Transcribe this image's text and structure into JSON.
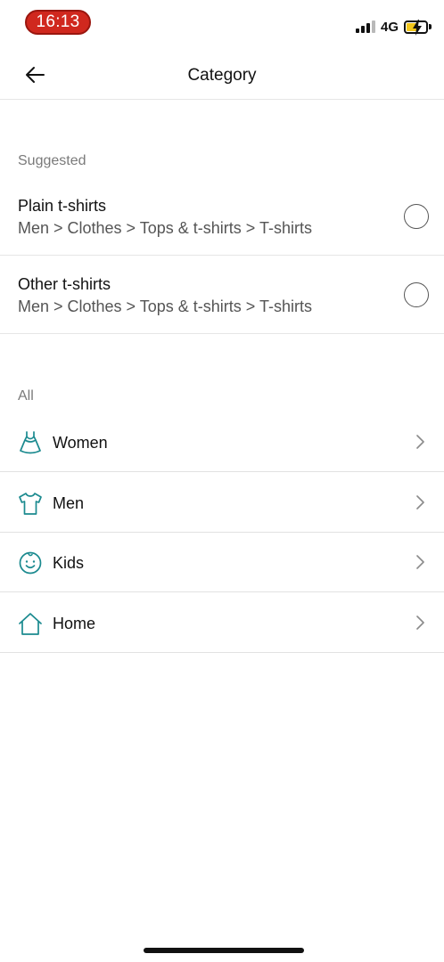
{
  "status_bar": {
    "time": "16:13",
    "network": "4G"
  },
  "nav": {
    "title": "Category",
    "back_icon": "arrow-left-icon"
  },
  "suggested": {
    "header": "Suggested",
    "items": [
      {
        "name": "Plain t-shirts",
        "path": "Men > Clothes > Tops & t-shirts > T-shirts"
      },
      {
        "name": "Other t-shirts",
        "path": "Men > Clothes > Tops & t-shirts > T-shirts"
      }
    ]
  },
  "all": {
    "header": "All",
    "items": [
      {
        "label": "Women",
        "icon": "dress-icon"
      },
      {
        "label": "Men",
        "icon": "tshirt-icon"
      },
      {
        "label": "Kids",
        "icon": "baby-face-icon"
      },
      {
        "label": "Home",
        "icon": "house-icon"
      }
    ]
  },
  "colors": {
    "accent": "#1b8a8f",
    "time_pill": "#d0281e",
    "battery": "#f2c61b",
    "divider": "#e6e6e6"
  }
}
